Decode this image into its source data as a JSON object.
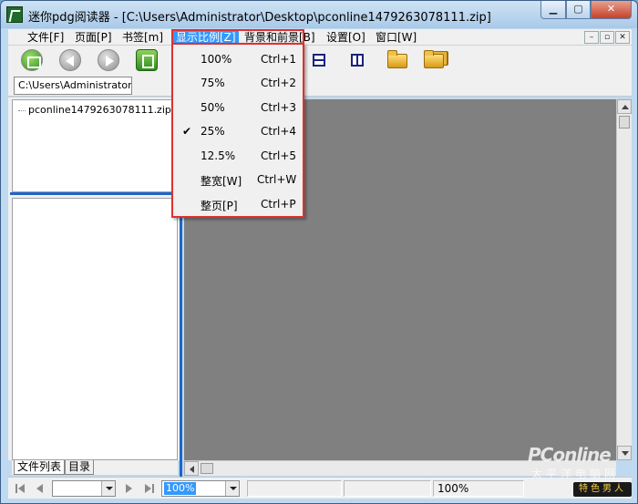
{
  "window": {
    "title": "迷你pdg阅读器 - [C:\\Users\\Administrator\\Desktop\\pconline1479263078111.zip]",
    "controls": {
      "minimize": "▁",
      "maximize": "▢",
      "close": "✕"
    }
  },
  "menubar": {
    "items": [
      {
        "label": "文件[F]"
      },
      {
        "label": "页面[P]"
      },
      {
        "label": "书签[m]"
      },
      {
        "label": "显示比例[Z]"
      },
      {
        "label": "背景和前景[B]"
      },
      {
        "label": "设置[O]"
      },
      {
        "label": "窗口[W]"
      }
    ],
    "mdi_controls": {
      "minimize": "–",
      "restore": "▫",
      "close": "✕"
    }
  },
  "toolbar": {
    "icons": [
      "open-file-icon",
      "previous-icon",
      "next-icon",
      "single-page-icon",
      "horizontal-split-icon",
      "vertical-split-icon",
      "folder-open-icon",
      "folders-icon"
    ]
  },
  "address": {
    "path": "C:\\Users\\Administrator\\D"
  },
  "file_tree": {
    "items": [
      "pconline1479263078111.zip"
    ]
  },
  "left_tabs": [
    {
      "label": "文件列表",
      "active": true
    },
    {
      "label": "目录",
      "active": false
    }
  ],
  "zoom_menu": {
    "items": [
      {
        "label": "100%",
        "shortcut": "Ctrl+1",
        "checked": false
      },
      {
        "label": "75%",
        "shortcut": "Ctrl+2",
        "checked": false
      },
      {
        "label": "50%",
        "shortcut": "Ctrl+3",
        "checked": false
      },
      {
        "label": "25%",
        "shortcut": "Ctrl+4",
        "checked": true
      },
      {
        "label": "12.5%",
        "shortcut": "Ctrl+5",
        "checked": false
      },
      {
        "label": "整宽[W]",
        "shortcut": "Ctrl+W",
        "checked": false
      },
      {
        "label": "整页[P]",
        "shortcut": "Ctrl+P",
        "checked": false
      }
    ],
    "check_mark": "✔"
  },
  "statusbar": {
    "page_value": "",
    "zoom_value": "100%",
    "zoom_readout": "100%"
  },
  "watermark": {
    "brand": "PConline",
    "sub": "太平洋电脑网",
    "badge": "特色男人"
  },
  "colors": {
    "viewer_bg": "#808080",
    "menu_highlight": "#3399ff",
    "annotation_border": "#e03030",
    "divider": "#1e66c8"
  }
}
